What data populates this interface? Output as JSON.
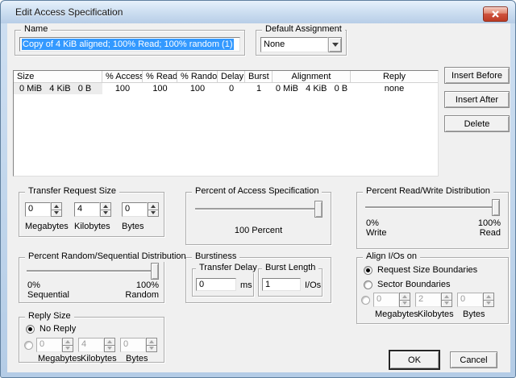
{
  "window": {
    "title": "Edit Access Specification"
  },
  "name_group": {
    "label": "Name",
    "value": "Copy of 4 KiB aligned; 100% Read; 100% random (1)"
  },
  "default_assignment": {
    "label": "Default Assignment",
    "value": "None"
  },
  "spec_table": {
    "columns": [
      "Size",
      "% Access",
      "% Read",
      "% Random",
      "Delay",
      "Burst",
      "Alignment",
      "Reply"
    ],
    "row": [
      "0 MiB   4 KiB   0 B",
      "100",
      "100",
      "100",
      "0",
      "1",
      "0 MiB   4 KiB   0 B",
      "none"
    ]
  },
  "actions": {
    "insert_before": "Insert Before",
    "insert_after": "Insert After",
    "delete": "Delete",
    "ok": "OK",
    "cancel": "Cancel"
  },
  "transfer_request_size": {
    "label": "Transfer Request Size",
    "megabytes": {
      "value": "0",
      "unit": "Megabytes"
    },
    "kilobytes": {
      "value": "4",
      "unit": "Kilobytes"
    },
    "bytes": {
      "value": "0",
      "unit": "Bytes"
    }
  },
  "percent_access_spec": {
    "label": "Percent of Access Specification",
    "value_label": "100 Percent",
    "percent": 100
  },
  "read_write_distribution": {
    "label": "Percent Read/Write Distribution",
    "left_percent": "0%",
    "left_label": "Write",
    "right_percent": "100%",
    "right_label": "Read",
    "percent_read": 100
  },
  "random_sequential_distribution": {
    "label": "Percent Random/Sequential Distribution",
    "left_percent": "0%",
    "left_label": "Sequential",
    "right_percent": "100%",
    "right_label": "Random",
    "percent_random": 100
  },
  "burstiness": {
    "label": "Burstiness",
    "transfer_delay": {
      "label": "Transfer Delay",
      "value": "0",
      "unit": "ms"
    },
    "burst_length": {
      "label": "Burst Length",
      "value": "1",
      "unit": "I/Os"
    }
  },
  "align_ios": {
    "label": "Align I/Os on",
    "option_request": "Request Size Boundaries",
    "option_sector": "Sector Boundaries",
    "selected": "request_size_boundaries",
    "custom": {
      "megabytes": {
        "value": "0",
        "unit": "Megabytes"
      },
      "kilobytes": {
        "value": "2",
        "unit": "Kilobytes"
      },
      "bytes": {
        "value": "0",
        "unit": "Bytes"
      }
    }
  },
  "reply_size": {
    "label": "Reply Size",
    "option_no_reply": "No Reply",
    "selected": "no_reply",
    "custom": {
      "megabytes": {
        "value": "0",
        "unit": "Megabytes"
      },
      "kilobytes": {
        "value": "4",
        "unit": "Kilobytes"
      },
      "bytes": {
        "value": "0",
        "unit": "Bytes"
      }
    }
  },
  "colors": {
    "selection": "#3399ff",
    "close_button": "#cf5440",
    "titlebar_top": "#e7f1fb",
    "titlebar_bottom": "#b7cde7",
    "dialog_bg": "#f0f0f0"
  }
}
